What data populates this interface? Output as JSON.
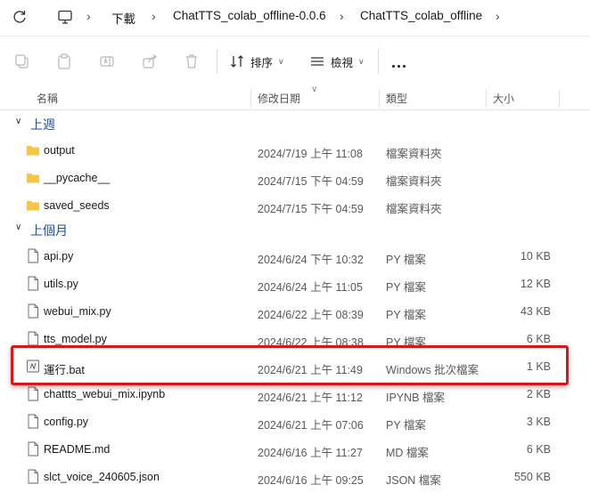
{
  "address_bar": {
    "breadcrumbs": [
      "下載",
      "ChatTTS_colab_offline-0.0.6",
      "ChatTTS_colab_offline"
    ]
  },
  "toolbar": {
    "sort_label": "排序",
    "view_label": "檢視",
    "icons": [
      "copy-icon",
      "paste-icon",
      "rename-icon",
      "share-icon",
      "delete-icon",
      "sort-icon",
      "view-icon",
      "more-icon"
    ]
  },
  "columns": {
    "name": "名稱",
    "date": "修改日期",
    "type": "類型",
    "size": "大小"
  },
  "groups": [
    {
      "label": "上週",
      "rows": [
        {
          "name": "output",
          "date": "2024/7/19 上午 11:08",
          "type": "檔案資料夾",
          "size": "",
          "icon": "folder-icon"
        },
        {
          "name": "__pycache__",
          "date": "2024/7/15 下午 04:59",
          "type": "檔案資料夾",
          "size": "",
          "icon": "folder-icon"
        },
        {
          "name": "saved_seeds",
          "date": "2024/7/15 下午 04:59",
          "type": "檔案資料夾",
          "size": "",
          "icon": "folder-icon"
        }
      ]
    },
    {
      "label": "上個月",
      "rows": [
        {
          "name": "api.py",
          "date": "2024/6/24 下午 10:32",
          "type": "PY 檔案",
          "size": "10 KB",
          "icon": "file-icon"
        },
        {
          "name": "utils.py",
          "date": "2024/6/24 上午 11:05",
          "type": "PY 檔案",
          "size": "12 KB",
          "icon": "file-icon"
        },
        {
          "name": "webui_mix.py",
          "date": "2024/6/22 上午 08:39",
          "type": "PY 檔案",
          "size": "43 KB",
          "icon": "file-icon"
        },
        {
          "name": "tts_model.py",
          "date": "2024/6/22 上午 08:38",
          "type": "PY 檔案",
          "size": "6 KB",
          "icon": "file-icon"
        },
        {
          "name": "運行.bat",
          "date": "2024/6/21 上午 11:49",
          "type": "Windows 批次檔案",
          "size": "1 KB",
          "icon": "batch-file-icon"
        },
        {
          "name": "chattts_webui_mix.ipynb",
          "date": "2024/6/21 上午 11:12",
          "type": "IPYNB 檔案",
          "size": "2 KB",
          "icon": "file-icon"
        },
        {
          "name": "config.py",
          "date": "2024/6/21 上午 07:06",
          "type": "PY 檔案",
          "size": "3 KB",
          "icon": "file-icon"
        },
        {
          "name": "README.md",
          "date": "2024/6/16 上午 11:27",
          "type": "MD 檔案",
          "size": "6 KB",
          "icon": "file-icon"
        },
        {
          "name": "slct_voice_240605.json",
          "date": "2024/6/16 上午 09:25",
          "type": "JSON 檔案",
          "size": "550 KB",
          "icon": "file-icon"
        }
      ]
    }
  ],
  "colors": {
    "group_label": "#1e4e9c",
    "folder": "#f5c64a",
    "highlight": "#d11a1a"
  }
}
